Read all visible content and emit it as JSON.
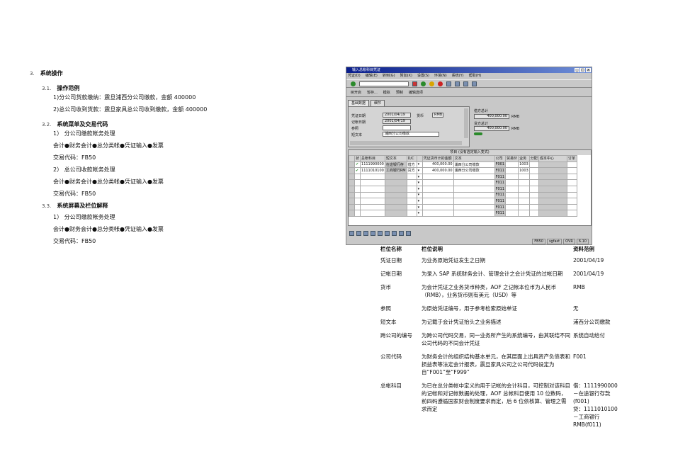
{
  "doc": {
    "s3": {
      "num": "3.",
      "title": "系统操作"
    },
    "s31": {
      "num": "3.1.",
      "title": "操作范例",
      "lines": [
        "1)分公司货款缴纳：震旦浦西分公司缴款，金额 400000",
        "2)总公司收到货款：震旦家具总公司收到缴款，金额 400000"
      ]
    },
    "s32": {
      "num": "3.2.",
      "title": "系统菜单及交易代码",
      "lines": [
        "1） 分公司缴款帐务处理",
        "会计●财务会计●总分类帐●凭证输入●发票",
        "交易代码：FB50",
        "2） 总公司收款帐务处理",
        "会计●财务会计●总分类帐●凭证输入●发票",
        "交易代码：FB50"
      ]
    },
    "s33": {
      "num": "3.3.",
      "title": "系统屏幕及栏位解释",
      "lines": [
        "1） 分公司缴款帐务处理",
        "会计●财务会计●总分类帐●凭证输入●发票",
        "交易代码：FB50"
      ]
    }
  },
  "sap": {
    "title": "输入总帐科目凭证",
    "menu": [
      "凭证(D)",
      "编辑(E)",
      "转到(G)",
      "附加(X)",
      "设置(S)",
      "环境(N)",
      "系统(Y)",
      "帮助(H)"
    ],
    "app_toolbar": [
      "树开启",
      "暂存...",
      "模拟",
      "预制",
      "编辑选项"
    ],
    "tabs": [
      "基础数据",
      "细节"
    ],
    "header": {
      "doc_date_label": "凭证日期",
      "doc_date": "2001/04/19",
      "currency_label": "货币",
      "currency": "RMB",
      "post_date_label": "记帐日期",
      "post_date": "2001/04/19",
      "ref_label": "参照",
      "ref": "",
      "text_label": "短文本",
      "text": "浦西分公司缴款"
    },
    "totals": {
      "debit_label": "借方总计",
      "debit": "400,000.00",
      "credit_label": "贷方总计",
      "credit": "400,000.00",
      "currency": "RMB"
    },
    "items_title": "项目 (没有选定输入变式)",
    "columns": [
      "状",
      "总帐科目",
      "短文本",
      "D/C",
      "凭证货币计的金额",
      "文本",
      "公司",
      "贸易伙",
      "业务",
      "分配",
      "成本中心",
      "订单"
    ],
    "rows": [
      [
        "1111990000",
        "在途银行存",
        "借方",
        "400,000.00",
        "浦西分公司缴款",
        "F001",
        "1003"
      ],
      [
        "1111010100",
        "工商银行RM",
        "贷方",
        "400,000.00",
        "浦西分公司缴款",
        "F011",
        "1003"
      ]
    ],
    "empty_company": "F011",
    "status": [
      "FB50",
      "sgfast",
      "OVR",
      "6.10"
    ]
  },
  "fields": {
    "headers": [
      "栏位名称",
      "栏位说明",
      "资料范例"
    ],
    "rows": [
      [
        "凭证日期",
        "为业务原始凭证发生之日期",
        "2001/04/19"
      ],
      [
        "记帐日期",
        "为录入 SAP 系统财务会计、管理会计之会计凭证的过帐日期",
        "2001/04/19"
      ],
      [
        "货币",
        "为会计凭证之业务货币种类，AOF 之记帐本位币为人民币（RMB），业务货币则有美元（USD）等",
        "RMB"
      ],
      [
        "参照",
        "为原始凭证编号，用于参考检索原始单证",
        "无"
      ],
      [
        "短文本",
        "为记载于会计凭证抬头之业务描述",
        "浦西分公司缴款"
      ],
      [
        "跨公司的编号",
        "为跨公司代码交易，同一业务所产生的系统编号，由其联结不同公司代码的不同会计凭证",
        "系统自动给付"
      ],
      [
        "公司代码",
        "为财务会计的组织结构基本单元，在其层面上出具资产负债表和损益表等法定会计报表，震旦家具公司之公司代码设定为自“F001”至“F999”",
        "F001"
      ],
      [
        "总帐科目",
        "为已在总分类帐中定义的用于记帐的会计科目，可控制对该科目的记帐和对记帐数据的处理，AOF 总帐科目使用 10 位数码，前四码遵循国家财会制度要求而定，后 6 位依核算、管理之需求而定",
        "借：1111990000\n－在途银行存款\n(f001)\n贷：1111010100\n－工商银行\nRMB(f011)"
      ]
    ]
  }
}
